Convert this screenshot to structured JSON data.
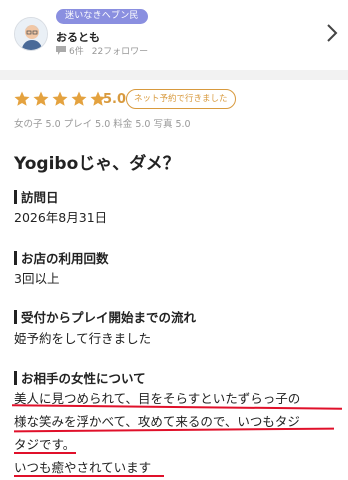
{
  "user": {
    "badge": "迷いなきヘブン民",
    "name": "おるとも",
    "reviews": "6件",
    "followers": "22フォロワー"
  },
  "review": {
    "rating": 5.0,
    "rating_label": "5.0",
    "net_reserve_tag": "ネット予約で行きました",
    "sub_ratings": "女の子 5.0 プレイ 5.0 料金 5.0 写真 5.0",
    "title": "Yogiboじゃ、ダメ？",
    "sections": [
      {
        "heading": "訪問日",
        "body": [
          "2026年8月31日"
        ]
      },
      {
        "heading": "お店の利用回数",
        "body": [
          "3回以上"
        ]
      },
      {
        "heading": "受付からプレイ開始までの流れ",
        "body": [
          "姫予約をして行きました"
        ]
      },
      {
        "heading": "お相手の女性について",
        "body": [
          "美人に見つめられて、目をそらすといたずらっ子の",
          "様な笑みを浮かべて、攻めて来るので、いつもタジ",
          "タジです。",
          "いつも癒やされています"
        ]
      }
    ]
  },
  "colors": {
    "badge": "#8a8fe0",
    "star": "#e4a23f",
    "score": "#d89a3e",
    "underline": "#e0102a"
  },
  "icons": {
    "avatar": "person-avatar-icon",
    "comment": "comment-icon",
    "chevron": "chevron-right-icon",
    "star": "star-icon"
  }
}
